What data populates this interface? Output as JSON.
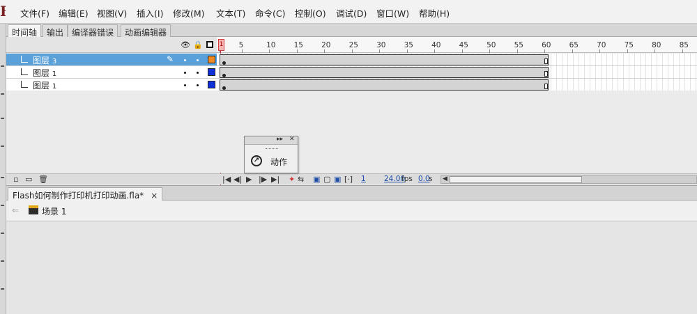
{
  "menubar": {
    "logo": "Fl",
    "items": [
      "文件(F)",
      "编辑(E)",
      "视图(V)",
      "插入(I)",
      "修改(M)",
      "文本(T)",
      "命令(C)",
      "控制(O)",
      "调试(D)",
      "窗口(W)",
      "帮助(H)"
    ]
  },
  "panel_tabs": [
    "时间轴",
    "输出",
    "编译器错误",
    "动画编辑器"
  ],
  "timeline": {
    "ruler_labels": [
      "1",
      "5",
      "10",
      "15",
      "20",
      "25",
      "30",
      "35",
      "40",
      "45",
      "50",
      "55",
      "60",
      "65",
      "70",
      "75",
      "80",
      "85"
    ],
    "current_frame": "1",
    "layers": [
      {
        "name": "图层",
        "num": "3",
        "selected": true,
        "color": "#f08a24"
      },
      {
        "name": "图层",
        "num": "1",
        "selected": false,
        "color": "#1030d8"
      },
      {
        "name": "图层",
        "num": "1",
        "selected": false,
        "color": "#1030d8"
      }
    ],
    "status": {
      "frame": "1",
      "fps_value": "24.00",
      "fps_unit": "fps",
      "time_value": "0.0",
      "time_unit": "s"
    }
  },
  "float_panel": {
    "button_label": "动作",
    "icon": "action-arrow-icon"
  },
  "document": {
    "tab_label": "Flash如何制作打印机打印动画.fla*",
    "close": "×",
    "scene_label": "场景 1"
  },
  "colors": {
    "selected_row": "#5aa0d9",
    "playhead": "#cc3333",
    "layer3_outline": "#f08a24",
    "layer1_outline": "#1030d8"
  }
}
